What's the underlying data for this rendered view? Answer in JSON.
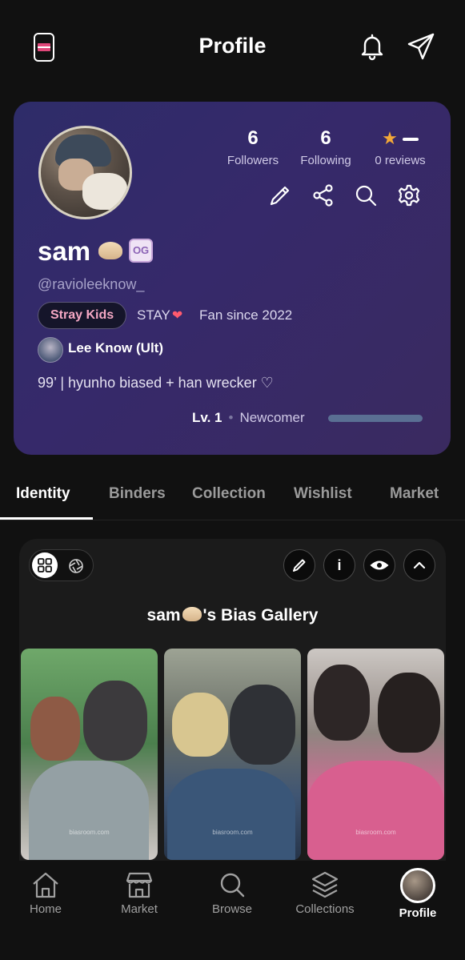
{
  "header": {
    "title": "Profile"
  },
  "profile": {
    "stats": {
      "followers_count": "6",
      "followers_label": "Followers",
      "following_count": "6",
      "following_label": "Following",
      "reviews_label": "0 reviews"
    },
    "name": "sam",
    "name_badge": "OG",
    "handle": "@ravioleeknow_",
    "group": "Stray Kids",
    "fandom": "STAY",
    "fan_since": "Fan since 2022",
    "bias": "Lee Know (Ult)",
    "bio": "99’ | hyunho biased + han wrecker ♡",
    "level": "Lv. 1",
    "rank": "Newcomer",
    "level_progress": 1.0
  },
  "tabs": [
    {
      "label": "Identity",
      "active": true
    },
    {
      "label": "Binders",
      "active": false
    },
    {
      "label": "Collection",
      "active": false
    },
    {
      "label": "Wishlist",
      "active": false
    },
    {
      "label": "Market",
      "active": false
    }
  ],
  "gallery": {
    "title_prefix": "sam",
    "title_suffix": "'s Bias Gallery",
    "watermark": "biasroom.com"
  },
  "nav": [
    {
      "label": "Home",
      "icon": "home-icon"
    },
    {
      "label": "Market",
      "icon": "store-icon"
    },
    {
      "label": "Browse",
      "icon": "search-icon"
    },
    {
      "label": "Collections",
      "icon": "layers-icon"
    },
    {
      "label": "Profile",
      "icon": "avatar"
    }
  ],
  "colors": {
    "background": "#111111",
    "card_gradient_start": "#2e2c69",
    "card_gradient_end": "#3a2a60",
    "group_pill_text": "#f5a8c4",
    "star": "#f2a838",
    "progress": "#5a6f93"
  }
}
